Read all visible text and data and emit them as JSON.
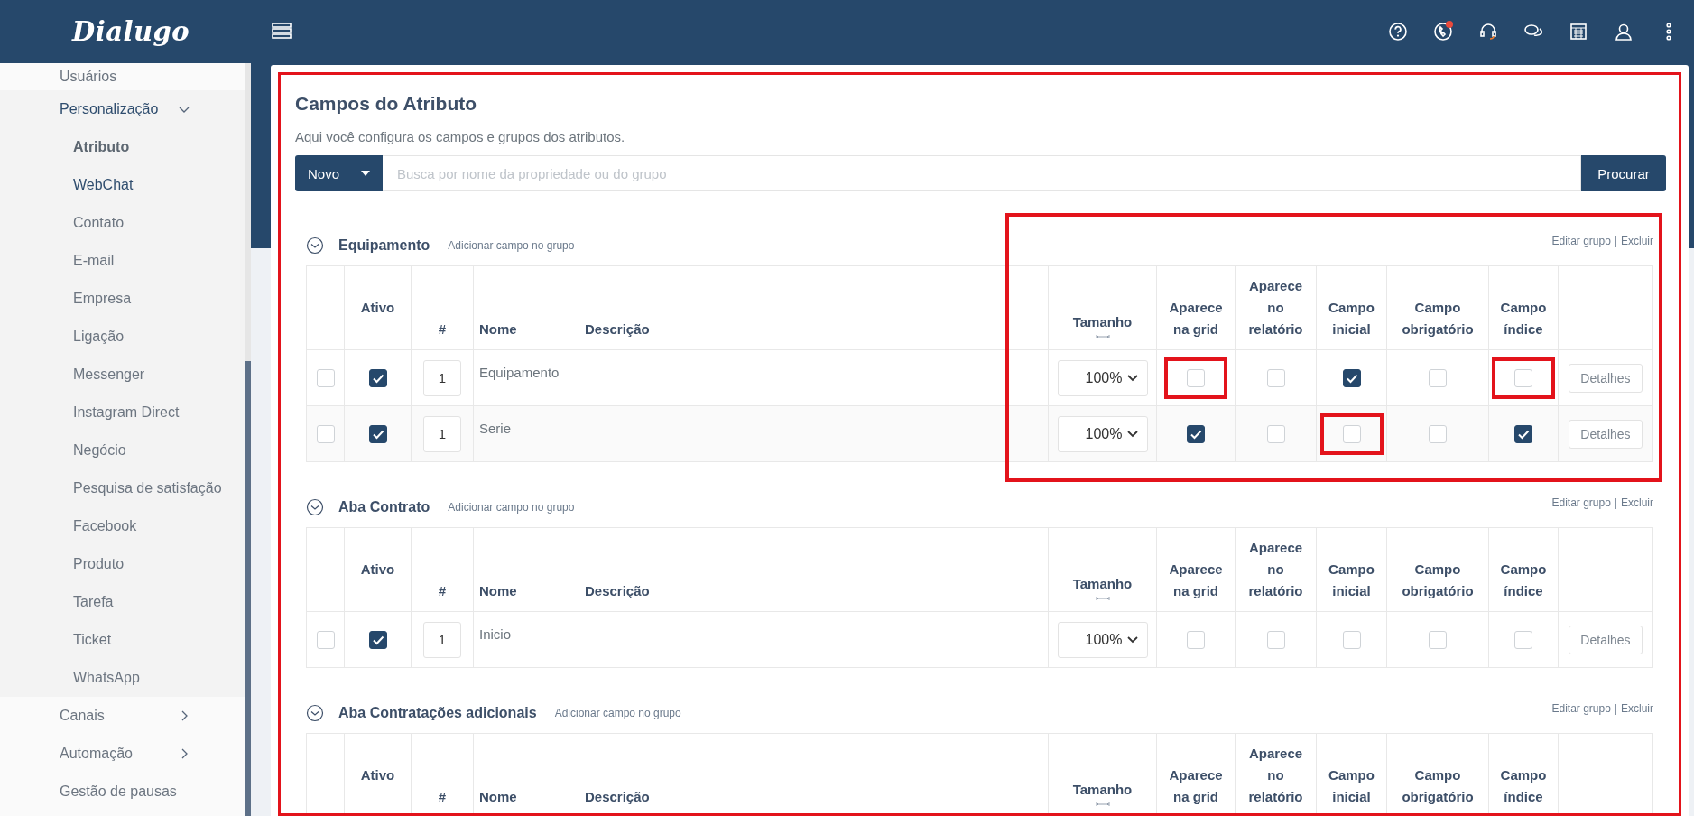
{
  "header": {
    "logo": "Dialugo",
    "notification_dot": true
  },
  "sidebar": {
    "items": [
      {
        "label": "Usuários",
        "expandable": false,
        "expanded": false
      },
      {
        "label": "Personalização",
        "expandable": true,
        "expanded": true,
        "children": [
          {
            "label": "Atributo",
            "selected": true,
            "hover": false
          },
          {
            "label": "WebChat",
            "selected": false,
            "hover": true
          },
          {
            "label": "Contato",
            "selected": false,
            "hover": false
          },
          {
            "label": "E-mail",
            "selected": false,
            "hover": false
          },
          {
            "label": "Empresa",
            "selected": false,
            "hover": false
          },
          {
            "label": "Ligação",
            "selected": false,
            "hover": false
          },
          {
            "label": "Messenger",
            "selected": false,
            "hover": false
          },
          {
            "label": "Instagram Direct",
            "selected": false,
            "hover": false
          },
          {
            "label": "Negócio",
            "selected": false,
            "hover": false
          },
          {
            "label": "Pesquisa de satisfação",
            "selected": false,
            "hover": false
          },
          {
            "label": "Facebook",
            "selected": false,
            "hover": false
          },
          {
            "label": "Produto",
            "selected": false,
            "hover": false
          },
          {
            "label": "Tarefa",
            "selected": false,
            "hover": false
          },
          {
            "label": "Ticket",
            "selected": false,
            "hover": false
          },
          {
            "label": "WhatsApp",
            "selected": false,
            "hover": false
          }
        ]
      },
      {
        "label": "Canais",
        "expandable": true,
        "expanded": false
      },
      {
        "label": "Automação",
        "expandable": true,
        "expanded": false
      },
      {
        "label": "Gestão de pausas",
        "expandable": false,
        "expanded": false
      }
    ]
  },
  "page": {
    "title": "Campos do Atributo",
    "subtitle": "Aqui você configura os campos e grupos dos atributos.",
    "highlighted": true,
    "new_button": "Novo",
    "search": {
      "placeholder": "Busca por nome da propriedade ou do grupo"
    },
    "search_button": "Procurar"
  },
  "groups": [
    {
      "name": "Equipamento",
      "expanded": true,
      "highlighted": true,
      "add_link": "Adicionar campo no grupo",
      "edit_link": "Editar grupo",
      "separator": "|",
      "delete_link": "Excluir",
      "columns": [
        {
          "kind": "blank"
        },
        {
          "kind": "text",
          "label": "Ativo"
        },
        {
          "kind": "text",
          "label": "#"
        },
        {
          "kind": "text",
          "label": "Nome"
        },
        {
          "kind": "text",
          "label": "Descrição"
        },
        {
          "kind": "resize",
          "label": "Tamanho"
        },
        {
          "kind": "text",
          "label": "Aparece na grid"
        },
        {
          "kind": "text",
          "label": "Aparece no relatório"
        },
        {
          "kind": "text",
          "label": "Campo inicial"
        },
        {
          "kind": "text",
          "label": "Campo obrigatório"
        },
        {
          "kind": "text",
          "label": "Campo índice"
        },
        {
          "kind": "blank"
        }
      ],
      "rows": [
        {
          "row_check": {
            "checked": false,
            "highlighted": false
          },
          "active": {
            "checked": true,
            "highlighted": false
          },
          "order": "1",
          "name": "Equipamento",
          "size": "100%",
          "grid": {
            "checked": false,
            "highlighted": true
          },
          "report": {
            "checked": false,
            "highlighted": false
          },
          "initial": {
            "checked": true,
            "highlighted": false
          },
          "required": {
            "checked": false,
            "highlighted": false
          },
          "index": {
            "checked": false,
            "highlighted": true
          },
          "details": "Detalhes"
        },
        {
          "row_check": {
            "checked": false,
            "highlighted": false
          },
          "active": {
            "checked": true,
            "highlighted": false
          },
          "order": "1",
          "name": "Serie",
          "size": "100%",
          "grid": {
            "checked": true,
            "highlighted": false
          },
          "report": {
            "checked": false,
            "highlighted": false
          },
          "initial": {
            "checked": false,
            "highlighted": true
          },
          "required": {
            "checked": false,
            "highlighted": false
          },
          "index": {
            "checked": true,
            "highlighted": false
          },
          "details": "Detalhes"
        }
      ]
    },
    {
      "name": "Aba Contrato",
      "expanded": true,
      "highlighted": false,
      "add_link": "Adicionar campo no grupo",
      "edit_link": "Editar grupo",
      "separator": "|",
      "delete_link": "Excluir",
      "columns": [
        {
          "kind": "blank"
        },
        {
          "kind": "text",
          "label": "Ativo"
        },
        {
          "kind": "text",
          "label": "#"
        },
        {
          "kind": "text",
          "label": "Nome"
        },
        {
          "kind": "text",
          "label": "Descrição"
        },
        {
          "kind": "resize",
          "label": "Tamanho"
        },
        {
          "kind": "text",
          "label": "Aparece na grid"
        },
        {
          "kind": "text",
          "label": "Aparece no relatório"
        },
        {
          "kind": "text",
          "label": "Campo inicial"
        },
        {
          "kind": "text",
          "label": "Campo obrigatório"
        },
        {
          "kind": "text",
          "label": "Campo índice"
        },
        {
          "kind": "blank"
        }
      ],
      "rows": [
        {
          "row_check": {
            "checked": false,
            "highlighted": false
          },
          "active": {
            "checked": true,
            "highlighted": false
          },
          "order": "1",
          "name": "Inicio",
          "size": "100%",
          "grid": {
            "checked": false,
            "highlighted": false
          },
          "report": {
            "checked": false,
            "highlighted": false
          },
          "initial": {
            "checked": false,
            "highlighted": false
          },
          "required": {
            "checked": false,
            "highlighted": false
          },
          "index": {
            "checked": false,
            "highlighted": false
          },
          "details": "Detalhes"
        }
      ]
    },
    {
      "name": "Aba Contratações adicionais",
      "expanded": true,
      "highlighted": false,
      "add_link": "Adicionar campo no grupo",
      "edit_link": "Editar grupo",
      "separator": "|",
      "delete_link": "Excluir",
      "columns": [
        {
          "kind": "blank"
        },
        {
          "kind": "text",
          "label": "Ativo"
        },
        {
          "kind": "text",
          "label": "#"
        },
        {
          "kind": "text",
          "label": "Nome"
        },
        {
          "kind": "text",
          "label": "Descrição"
        },
        {
          "kind": "resize",
          "label": "Tamanho"
        },
        {
          "kind": "text",
          "label": "Aparece na grid"
        },
        {
          "kind": "text",
          "label": "Aparece no relatório"
        },
        {
          "kind": "text",
          "label": "Campo inicial"
        },
        {
          "kind": "text",
          "label": "Campo obrigatório"
        },
        {
          "kind": "text",
          "label": "Campo índice"
        },
        {
          "kind": "blank"
        }
      ]
    }
  ]
}
